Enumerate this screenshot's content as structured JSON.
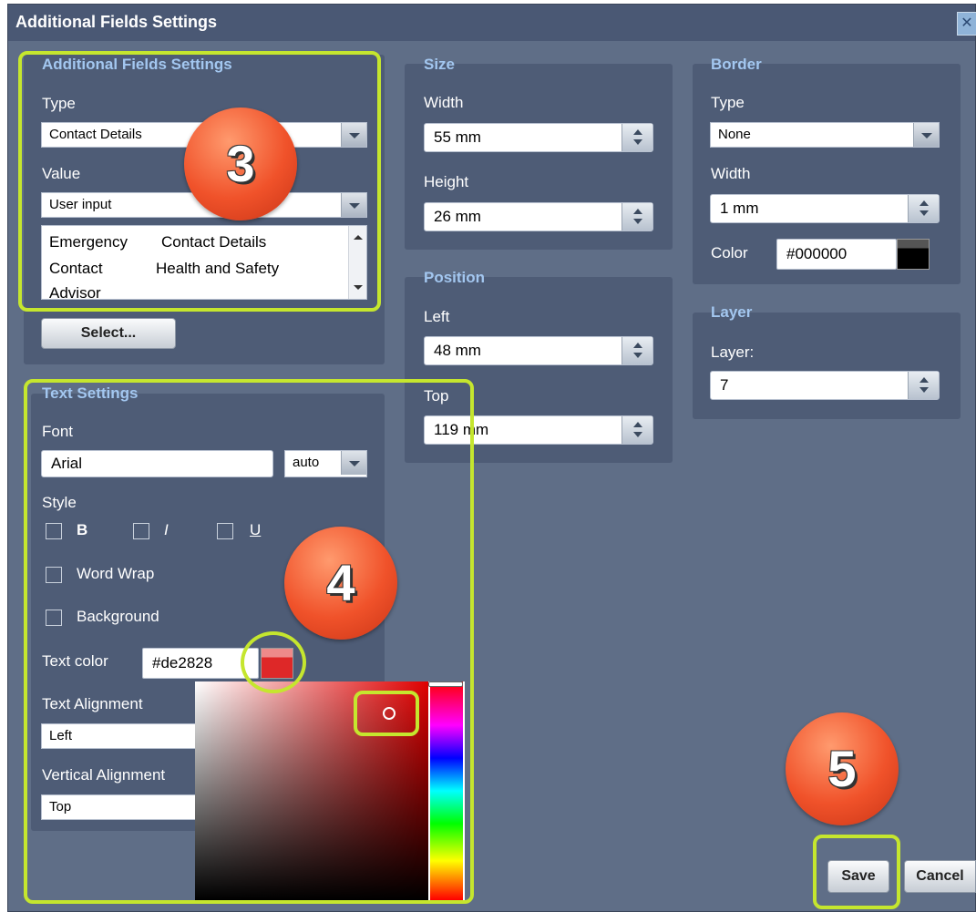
{
  "window": {
    "title": "Additional Fields Settings",
    "close_glyph": "✕"
  },
  "additional_fields": {
    "title": "Additional Fields Settings",
    "type_label": "Type",
    "type_value": "Contact Details",
    "value_label": "Value",
    "value_value": "User input",
    "list_items": [
      "Emergency",
      "Contact Details",
      "Contact",
      "Health and Safety",
      "Advisor"
    ],
    "select_button": "Select..."
  },
  "size": {
    "title": "Size",
    "width_label": "Width",
    "width_value": "55 mm",
    "height_label": "Height",
    "height_value": "26 mm"
  },
  "position": {
    "title": "Position",
    "left_label": "Left",
    "left_value": "48 mm",
    "top_label": "Top",
    "top_value": "119 mm"
  },
  "border": {
    "title": "Border",
    "type_label": "Type",
    "type_value": "None",
    "width_label": "Width",
    "width_value": "1 mm",
    "color_label": "Color",
    "color_value": "#000000"
  },
  "layer": {
    "title": "Layer",
    "layer_label": "Layer:",
    "layer_value": "7"
  },
  "text_settings": {
    "title": "Text Settings",
    "font_label": "Font",
    "font_value": "Arial",
    "font_size_value": "auto",
    "style_label": "Style",
    "bold_label": "B",
    "italic_label": "I",
    "underline_label": "U",
    "bold_checked": false,
    "italic_checked": false,
    "underline_checked": false,
    "word_wrap_label": "Word Wrap",
    "word_wrap_checked": false,
    "background_label": "Background",
    "background_checked": false,
    "text_color_label": "Text color",
    "text_color_value": "#de2828",
    "text_alignment_label": "Text Alignment",
    "text_alignment_value": "Left",
    "vertical_alignment_label": "Vertical Alignment",
    "vertical_alignment_value": "Top"
  },
  "footer": {
    "save_label": "Save",
    "cancel_label": "Cancel"
  },
  "annotations": {
    "step_3": "3",
    "step_4": "4",
    "step_5": "5"
  },
  "colors": {
    "dialog_bg": "#5f6e87",
    "group_bg": "#4e5c76",
    "group_title": "#a3c7f0",
    "highlight": "#c5e62e",
    "badge": "#f0522a",
    "text_color_swatch": "#de2828",
    "border_color_swatch": "#000000"
  }
}
